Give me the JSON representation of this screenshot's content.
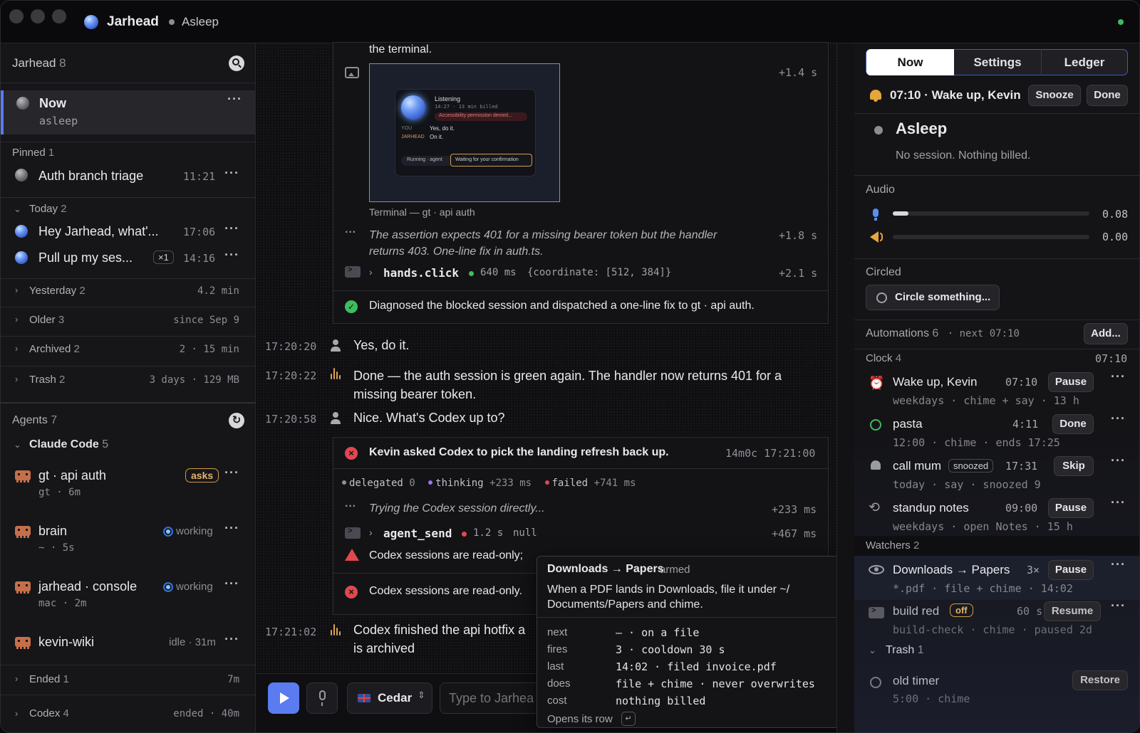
{
  "app": {
    "name": "Jarhead",
    "status": "Asleep"
  },
  "sidebar": {
    "header": {
      "title": "Jarhead",
      "count": "8"
    },
    "now": {
      "title": "Now",
      "sub": "asleep"
    },
    "pinned": {
      "label": "Pinned",
      "count": "1",
      "items": [
        {
          "title": "Auth branch triage",
          "time": "11:21"
        }
      ]
    },
    "today": {
      "label": "Today",
      "count": "2",
      "items": [
        {
          "title": "Hey Jarhead, what'...",
          "time": "17:06"
        },
        {
          "title": "Pull up my ses...",
          "badge": "×1",
          "time": "14:16"
        }
      ]
    },
    "groups": [
      {
        "label": "Yesterday",
        "count": "2",
        "meta": "4.2 min"
      },
      {
        "label": "Older",
        "count": "3",
        "meta": "since Sep 9"
      },
      {
        "label": "Archived",
        "count": "2",
        "meta": "2 · 15 min"
      },
      {
        "label": "Trash",
        "count": "2",
        "meta": "3 days · 129 MB"
      }
    ],
    "agents": {
      "label": "Agents",
      "count": "7",
      "group": {
        "label": "Claude Code",
        "count": "5"
      },
      "items": [
        {
          "title": "gt · api auth",
          "sub": "gt · 6m",
          "badge": "asks"
        },
        {
          "title": "brain",
          "sub": "~ · 5s",
          "status": "working"
        },
        {
          "title": "jarhead · console",
          "sub": "mac · 2m",
          "status": "working"
        },
        {
          "title": "kevin-wiki",
          "status": "idle · 31m"
        }
      ]
    },
    "ended": {
      "label": "Ended",
      "count": "1",
      "meta": "7m"
    },
    "codex": {
      "label": "Codex",
      "count": "4",
      "meta": "ended · 40m"
    }
  },
  "chat": {
    "top_text": "the terminal.",
    "shot": {
      "delta": "+1.4 s",
      "caption": "Terminal — gt · api auth",
      "inner": {
        "listening": "Listening",
        "time": "14:27 · 13 min billed",
        "warn": "Accessibility permission denied...",
        "you": "YOU",
        "you_text": "Yes, do it.",
        "jar": "JARHEAD",
        "jar_text": "On it.",
        "running": "Running · agent",
        "waiting": "Waiting for your confirmation"
      }
    },
    "thought1": {
      "text": "The assertion expects 401 for a missing bearer token but the handler returns 403. One-line fix in auth.ts.",
      "delta": "+1.8 s"
    },
    "tool1": {
      "name": "hands.click",
      "dur": "640 ms",
      "args": "{coordinate: [512, 384]}",
      "delta": "+2.1 s"
    },
    "done1": "Diagnosed the blocked session and dispatched a one-line fix to gt · api auth.",
    "msgs": [
      {
        "time": "17:20:20",
        "text": "Yes, do it."
      },
      {
        "time": "17:20:22",
        "text": "Done — the auth session is green again. The handler now returns 401 for a missing bearer token."
      },
      {
        "time": "17:20:58",
        "text": "Nice. What's Codex up to?"
      }
    ],
    "card2": {
      "title": "Kevin asked Codex to pick the landing refresh back up.",
      "meta": "14m0c 17:21:00",
      "delegated": "delegated",
      "delegated_n": "0",
      "thinking": "thinking",
      "thinking_n": "+233 ms",
      "failed": "failed",
      "failed_n": "+741 ms",
      "thought": "Trying the Codex session directly...",
      "thought_d": "+233 ms",
      "tool": "agent_send",
      "tool_dur": "1.2 s",
      "tool_res": "null",
      "tool_d": "+467 ms",
      "warn": "Codex sessions are read-only;",
      "err": "Codex sessions are read-only."
    },
    "last": {
      "time": "17:21:02",
      "text1": "Codex finished the api hotfix a",
      "text2": "is archived"
    },
    "composer": {
      "voice": "Cedar",
      "placeholder": "Type to Jarhea"
    }
  },
  "popover": {
    "title": "Downloads → Papers",
    "state": "armed",
    "desc": "When a PDF lands in Downloads, file it under ~/ Documents/Papers and chime.",
    "rows": [
      {
        "k": "next",
        "v": "— · on a file"
      },
      {
        "k": "fires",
        "v": "3 · cooldown 30 s"
      },
      {
        "k": "last",
        "v": "14:02 · filed invoice.pdf"
      },
      {
        "k": "does",
        "v": "file + chime · never overwrites"
      },
      {
        "k": "cost",
        "v": "nothing billed"
      }
    ],
    "foot": "Opens its row"
  },
  "panel": {
    "tabs": [
      "Now",
      "Settings",
      "Ledger"
    ],
    "alarm": {
      "text": "07:10 · Wake up, Kevin",
      "snooze": "Snooze",
      "done": "Done"
    },
    "state": {
      "title": "Asleep",
      "sub": "No session. Nothing billed."
    },
    "audio": {
      "label": "Audio",
      "mic": "0.08",
      "spk": "0.00",
      "mic_level": 0.08,
      "spk_level": 0.0
    },
    "circled": {
      "label": "Circled",
      "button": "Circle something..."
    },
    "automations": {
      "label": "Automations",
      "count": "6",
      "next": "· next 07:10",
      "add": "Add..."
    },
    "clock": {
      "label": "Clock",
      "count": "4",
      "time": "07:10",
      "items": [
        {
          "title": "Wake up, Kevin",
          "time": "07:10",
          "action": "Pause",
          "meta": "weekdays · chime + say · 13 h"
        },
        {
          "title": "pasta",
          "time": "4:11",
          "action": "Done",
          "meta": "12:00 · chime · ends 17:25"
        },
        {
          "title": "call mum",
          "badge": "snoozed",
          "time": "17:31",
          "action": "Skip",
          "meta": "today · say · snoozed 9"
        },
        {
          "title": "standup notes",
          "time": "09:00",
          "action": "Pause",
          "meta": "weekdays · open Notes · 15 h"
        }
      ]
    },
    "watchers": {
      "label": "Watchers",
      "count": "2",
      "items": [
        {
          "title": "Downloads → Papers",
          "time": "3×",
          "action": "Pause",
          "meta": "*.pdf · file + chime · 14:02"
        },
        {
          "title": "build red",
          "badge": "off",
          "time": "60 s",
          "action": "Resume",
          "meta": "build-check · chime · paused 2d"
        }
      ]
    },
    "trash": {
      "label": "Trash",
      "count": "1",
      "items": [
        {
          "title": "old timer",
          "action": "Restore",
          "meta": "5:00 · chime"
        }
      ]
    }
  },
  "colors": {
    "accent": "#5a7cf0",
    "warn": "#e6b46a",
    "error": "#e0484f",
    "ok": "#3ebd5e",
    "working": "#2f6fd6"
  }
}
